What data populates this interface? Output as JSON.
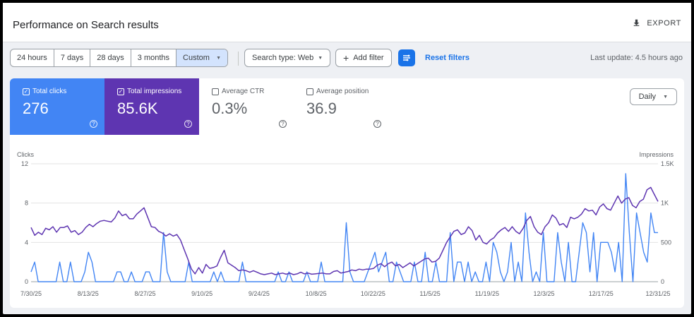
{
  "header": {
    "title": "Performance on Search results",
    "export_label": "EXPORT"
  },
  "filters": {
    "date_ranges": [
      "24 hours",
      "7 days",
      "28 days",
      "3 months",
      "Custom"
    ],
    "active_range": "Custom",
    "search_type": "Search type: Web",
    "add_filter": "Add filter",
    "reset": "Reset filters",
    "last_update": "Last update: 4.5 hours ago"
  },
  "metrics": [
    {
      "label": "Total clicks",
      "value": "276",
      "checked": true,
      "color": "#4285f4"
    },
    {
      "label": "Total impressions",
      "value": "85.6K",
      "checked": true,
      "color": "#5e35b1"
    },
    {
      "label": "Average CTR",
      "value": "0.3%",
      "checked": false
    },
    {
      "label": "Average position",
      "value": "36.9",
      "checked": false
    }
  ],
  "granularity": "Daily",
  "chart_data": {
    "type": "line",
    "left_axis": {
      "label": "Clicks",
      "ticks": [
        "12",
        "8",
        "4",
        "0"
      ],
      "range": [
        0,
        12
      ]
    },
    "right_axis": {
      "label": "Impressions",
      "ticks": [
        "1.5K",
        "1K",
        "500",
        "0"
      ],
      "range": [
        0,
        1500
      ]
    },
    "x_tick_labels": [
      "7/30/25",
      "8/13/25",
      "8/27/25",
      "9/10/25",
      "9/24/25",
      "10/8/25",
      "10/22/25",
      "11/5/25",
      "11/19/25",
      "12/3/25",
      "12/17/25",
      "12/31/25"
    ],
    "x_start": "2025-07-30",
    "grid": true,
    "series": [
      {
        "name": "Clicks",
        "axis": "left",
        "color": "#4285f4",
        "values": [
          1,
          2,
          0,
          0,
          0,
          0,
          0,
          0,
          2,
          0,
          0,
          2,
          0,
          0,
          0,
          1,
          3,
          2,
          0,
          0,
          0,
          0,
          0,
          0,
          1,
          1,
          0,
          0,
          1,
          0,
          0,
          0,
          1,
          1,
          0,
          0,
          0,
          5,
          1,
          0,
          0,
          0,
          0,
          0,
          2,
          0,
          0,
          0,
          0,
          0,
          0,
          1,
          0,
          1,
          0,
          0,
          0,
          0,
          0,
          2,
          0,
          0,
          0,
          0,
          0,
          0,
          0,
          0,
          0,
          1,
          0,
          0,
          1,
          0,
          0,
          0,
          0,
          1,
          0,
          0,
          0,
          2,
          0,
          0,
          0,
          0,
          0,
          0,
          6,
          1,
          0,
          0,
          0,
          0,
          1,
          2,
          3,
          1,
          2,
          3,
          0,
          0,
          2,
          1,
          0,
          0,
          0,
          2,
          0,
          0,
          3,
          0,
          0,
          2,
          0,
          0,
          0,
          5,
          0,
          2,
          2,
          0,
          2,
          0,
          1,
          0,
          0,
          2,
          0,
          4,
          3,
          1,
          0,
          1,
          4,
          0,
          2,
          0,
          7,
          3,
          0,
          1,
          0,
          5,
          0,
          0,
          0,
          5,
          2,
          0,
          4,
          0,
          0,
          3,
          6,
          5,
          1,
          5,
          0,
          4,
          4,
          4,
          3,
          1,
          4,
          0,
          11,
          5,
          0,
          7,
          5,
          3,
          2,
          7,
          5,
          5
        ]
      },
      {
        "name": "Impressions",
        "axis": "right",
        "color": "#5e35b1",
        "values": [
          690,
          590,
          630,
          600,
          680,
          660,
          700,
          630,
          690,
          690,
          710,
          630,
          650,
          600,
          630,
          690,
          730,
          700,
          740,
          770,
          780,
          770,
          760,
          810,
          900,
          840,
          860,
          800,
          800,
          860,
          900,
          940,
          820,
          700,
          690,
          640,
          620,
          580,
          610,
          580,
          600,
          530,
          410,
          290,
          160,
          100,
          180,
          110,
          220,
          170,
          180,
          200,
          310,
          400,
          240,
          210,
          180,
          140,
          150,
          140,
          120,
          140,
          120,
          100,
          90,
          100,
          110,
          90,
          100,
          110,
          95,
          110,
          90,
          100,
          120,
          100,
          110,
          95,
          100,
          105,
          110,
          100,
          100,
          130,
          140,
          110,
          120,
          130,
          150,
          140,
          160,
          150,
          160,
          160,
          170,
          210,
          230,
          190,
          230,
          250,
          200,
          220,
          180,
          210,
          240,
          200,
          230,
          260,
          290,
          300,
          250,
          260,
          300,
          400,
          500,
          570,
          640,
          660,
          600,
          620,
          700,
          650,
          530,
          590,
          500,
          480,
          530,
          560,
          620,
          660,
          690,
          640,
          700,
          640,
          610,
          680,
          780,
          830,
          700,
          630,
          600,
          700,
          750,
          850,
          810,
          720,
          740,
          690,
          820,
          800,
          820,
          860,
          930,
          900,
          910,
          850,
          950,
          990,
          930,
          910,
          1000,
          1090,
          1000,
          1050,
          1070,
          970,
          940,
          1020,
          1050,
          1170,
          1200,
          1110,
          1020
        ]
      }
    ]
  }
}
